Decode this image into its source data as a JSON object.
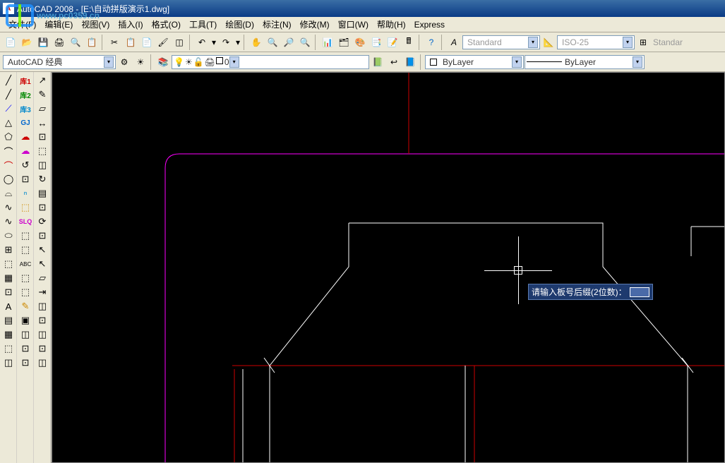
{
  "titlebar": {
    "icon_text": "A",
    "text": "AutoCAD 2008 - [E:\\自动拼版演示1.dwg]"
  },
  "watermark": "www.pc0359.cn",
  "menu": {
    "items": [
      "文件(F)",
      "编辑(E)",
      "视图(V)",
      "插入(I)",
      "格式(O)",
      "工具(T)",
      "绘图(D)",
      "标注(N)",
      "修改(M)",
      "窗口(W)",
      "帮助(H)",
      "Express"
    ]
  },
  "toolbar1": {
    "workspace_combo": "AutoCAD 经典"
  },
  "properties": {
    "text_style": "Standard",
    "dim_style": "ISO-25",
    "table_style": "Standar",
    "layer_name": "0",
    "color": "ByLayer",
    "linetype": "ByLayer"
  },
  "prompt": {
    "text": "请输入板号后缀(2位数)："
  },
  "left_tools_col1": [
    "╱",
    "╱",
    "⟋",
    "△",
    "⬠",
    "⌒",
    "⌒",
    "◯",
    "⌓",
    "∿",
    "∿",
    "⬭",
    "⊞",
    "⬚",
    "▦",
    "⊡",
    "A",
    "▤",
    "▦",
    "⬚",
    "◫"
  ],
  "left_tools_col2": [
    "库1",
    "库2",
    "库3",
    "GJ",
    "☁",
    "☁",
    "↺",
    "⊡",
    "ⁿ",
    "⬚",
    "SLQ",
    "⬚",
    "⬚",
    "ABC",
    "⬚",
    "⬚",
    "✎",
    "▣",
    "◫",
    "⊡",
    "⊡"
  ],
  "left_tools_col3": [
    "↗",
    "✎",
    "▱",
    "↔",
    "⊡",
    "⬚",
    "◫",
    "↻",
    "▤",
    "⊡",
    "⟳",
    "⊡",
    "↖",
    "↖",
    "▱",
    "⇥",
    "◫",
    "⊡",
    "◫",
    "⊡",
    "◫"
  ]
}
